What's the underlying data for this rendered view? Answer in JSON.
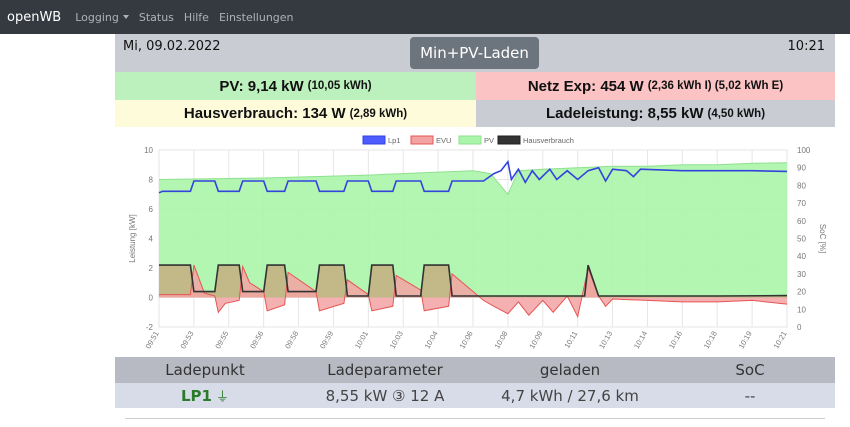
{
  "nav": {
    "brand": "openWB",
    "logging": "Logging",
    "status": "Status",
    "hilfe": "Hilfe",
    "einstellungen": "Einstellungen"
  },
  "header": {
    "date": "Mi, 09.02.2022",
    "mode": "Min+PV-Laden",
    "time": "10:21"
  },
  "stats": {
    "pv_main": "PV: 9,14 kW",
    "pv_sub": "(10,05 kWh)",
    "netz_main": "Netz Exp: 454 W",
    "netz_sub": "(2,36 kWh I) (5,02 kWh E)",
    "haus_main": "Hausverbrauch: 134 W",
    "haus_sub": "(2,89 kWh)",
    "lade_main": "Ladeleistung: 8,55 kW",
    "lade_sub": "(4,50 kWh)"
  },
  "colors": {
    "pv_fill": "#aaf5aa",
    "pv_line": "#8fe08f",
    "evu_fill": "#f3a3a3",
    "evu_line": "#e55555",
    "lp1_line": "#3344dd",
    "haus_line": "#333333",
    "haus_fill": "#c8a47a"
  },
  "chart_data": {
    "type": "line",
    "ylabel": "Leistung [kW]",
    "y2label": "SoC [%]",
    "ylim": [
      -2,
      10
    ],
    "y2lim": [
      0,
      100
    ],
    "yticks": [
      -2,
      0,
      2,
      4,
      6,
      8,
      10
    ],
    "y2ticks": [
      0,
      10,
      20,
      30,
      40,
      50,
      60,
      70,
      80,
      90,
      100
    ],
    "xticks": [
      "09:51",
      "09:53",
      "09:55",
      "09:56",
      "09:58",
      "09:59",
      "10:01",
      "10:03",
      "10:04",
      "10:06",
      "10:08",
      "10:09",
      "10:11",
      "10:13",
      "10:14",
      "10:16",
      "10:18",
      "10:19",
      "10:21"
    ],
    "legend": [
      "Lp1",
      "EVU",
      "PV",
      "Hausverbrauch"
    ],
    "series": [
      {
        "name": "Lp1",
        "points": [
          [
            0,
            7.1
          ],
          [
            0.1,
            7.2
          ],
          [
            0.9,
            7.2
          ],
          [
            1.0,
            7.9
          ],
          [
            1.6,
            7.9
          ],
          [
            1.7,
            7.2
          ],
          [
            2.3,
            7.2
          ],
          [
            2.4,
            7.9
          ],
          [
            3.0,
            7.9
          ],
          [
            3.1,
            7.2
          ],
          [
            3.6,
            7.2
          ],
          [
            3.7,
            7.9
          ],
          [
            4.5,
            7.9
          ],
          [
            4.6,
            7.2
          ],
          [
            5.3,
            7.2
          ],
          [
            5.4,
            7.9
          ],
          [
            6.0,
            7.9
          ],
          [
            6.1,
            7.2
          ],
          [
            6.7,
            7.2
          ],
          [
            6.8,
            7.9
          ],
          [
            7.5,
            7.9
          ],
          [
            7.6,
            7.2
          ],
          [
            8.3,
            7.2
          ],
          [
            8.4,
            7.9
          ],
          [
            9.3,
            7.9
          ],
          [
            9.6,
            8.4
          ],
          [
            9.8,
            8.6
          ],
          [
            10.0,
            9.2
          ],
          [
            10.1,
            8.0
          ],
          [
            10.3,
            8.7
          ],
          [
            10.5,
            7.8
          ],
          [
            10.7,
            8.6
          ],
          [
            10.9,
            8.0
          ],
          [
            11.2,
            8.7
          ],
          [
            11.4,
            8.0
          ],
          [
            11.7,
            8.6
          ],
          [
            12.0,
            8.0
          ],
          [
            12.3,
            8.6
          ],
          [
            12.6,
            8.8
          ],
          [
            12.8,
            7.9
          ],
          [
            13.0,
            8.7
          ],
          [
            13.4,
            8.6
          ],
          [
            13.6,
            8.2
          ],
          [
            13.8,
            8.7
          ],
          [
            15,
            8.6
          ],
          [
            16,
            8.6
          ],
          [
            17,
            8.6
          ],
          [
            18,
            8.55
          ]
        ]
      },
      {
        "name": "EVU",
        "points": [
          [
            0,
            0.2
          ],
          [
            0.9,
            0.2
          ],
          [
            1.0,
            2.2
          ],
          [
            1.3,
            0.3
          ],
          [
            1.6,
            0.1
          ],
          [
            1.7,
            -1.0
          ],
          [
            1.9,
            -0.4
          ],
          [
            2.3,
            -0.2
          ],
          [
            2.4,
            2.1
          ],
          [
            2.6,
            1.0
          ],
          [
            3.0,
            0.4
          ],
          [
            3.1,
            -0.9
          ],
          [
            3.6,
            -0.5
          ],
          [
            3.7,
            1.7
          ],
          [
            4.5,
            0.4
          ],
          [
            4.6,
            -0.9
          ],
          [
            5.3,
            -0.4
          ],
          [
            5.4,
            1.2
          ],
          [
            6.0,
            0.2
          ],
          [
            6.1,
            -0.9
          ],
          [
            6.7,
            -0.6
          ],
          [
            6.8,
            1.5
          ],
          [
            7.5,
            0.5
          ],
          [
            7.6,
            -0.9
          ],
          [
            8.3,
            -0.6
          ],
          [
            8.4,
            1.6
          ],
          [
            9.3,
            -0.2
          ],
          [
            9.6,
            -0.6
          ],
          [
            10.0,
            -1.1
          ],
          [
            10.3,
            -0.3
          ],
          [
            10.6,
            -1.2
          ],
          [
            11.0,
            -0.2
          ],
          [
            11.3,
            -1.0
          ],
          [
            11.7,
            0.1
          ],
          [
            12.0,
            -1.3
          ],
          [
            12.3,
            2.0
          ],
          [
            12.6,
            0.1
          ],
          [
            12.8,
            -0.6
          ],
          [
            13.0,
            -0.1
          ],
          [
            14,
            -0.2
          ],
          [
            15,
            -0.3
          ],
          [
            16,
            -0.3
          ],
          [
            17,
            -0.2
          ],
          [
            18,
            -0.45
          ]
        ]
      },
      {
        "name": "PV",
        "points": [
          [
            0,
            8.0
          ],
          [
            3,
            8.1
          ],
          [
            6,
            8.3
          ],
          [
            8,
            8.5
          ],
          [
            9,
            8.6
          ],
          [
            9.5,
            8.4
          ],
          [
            10.0,
            7.0
          ],
          [
            10.3,
            8.6
          ],
          [
            11,
            8.7
          ],
          [
            12,
            8.8
          ],
          [
            13,
            8.9
          ],
          [
            14,
            8.9
          ],
          [
            15,
            9.0
          ],
          [
            16,
            9.0
          ],
          [
            17,
            9.1
          ],
          [
            18,
            9.14
          ]
        ]
      },
      {
        "name": "Hausverbrauch",
        "points": [
          [
            0,
            2.2
          ],
          [
            0.9,
            2.2
          ],
          [
            1.0,
            0.4
          ],
          [
            1.6,
            0.4
          ],
          [
            1.7,
            2.2
          ],
          [
            2.3,
            2.2
          ],
          [
            2.4,
            0.4
          ],
          [
            3.0,
            0.4
          ],
          [
            3.1,
            2.2
          ],
          [
            3.6,
            2.2
          ],
          [
            3.7,
            0.4
          ],
          [
            4.5,
            0.4
          ],
          [
            4.6,
            2.2
          ],
          [
            5.3,
            2.2
          ],
          [
            5.4,
            0.1
          ],
          [
            6.0,
            0.1
          ],
          [
            6.1,
            2.2
          ],
          [
            6.7,
            2.2
          ],
          [
            6.8,
            0.1
          ],
          [
            7.5,
            0.1
          ],
          [
            7.6,
            2.2
          ],
          [
            8.3,
            2.2
          ],
          [
            8.4,
            0.1
          ],
          [
            12.2,
            0.1
          ],
          [
            12.3,
            2.2
          ],
          [
            12.6,
            0.1
          ],
          [
            14,
            0.1
          ],
          [
            16,
            0.1
          ],
          [
            18,
            0.13
          ]
        ]
      }
    ]
  },
  "table": {
    "headers": [
      "Ladepunkt",
      "Ladeparameter",
      "geladen",
      "SoC"
    ],
    "row": {
      "lp": "LP1",
      "plug_icon": "plug-icon",
      "param": "8,55 kW ③ 12 A",
      "geladen": "4,7 kWh / 27,6 km",
      "soc": "--"
    }
  }
}
